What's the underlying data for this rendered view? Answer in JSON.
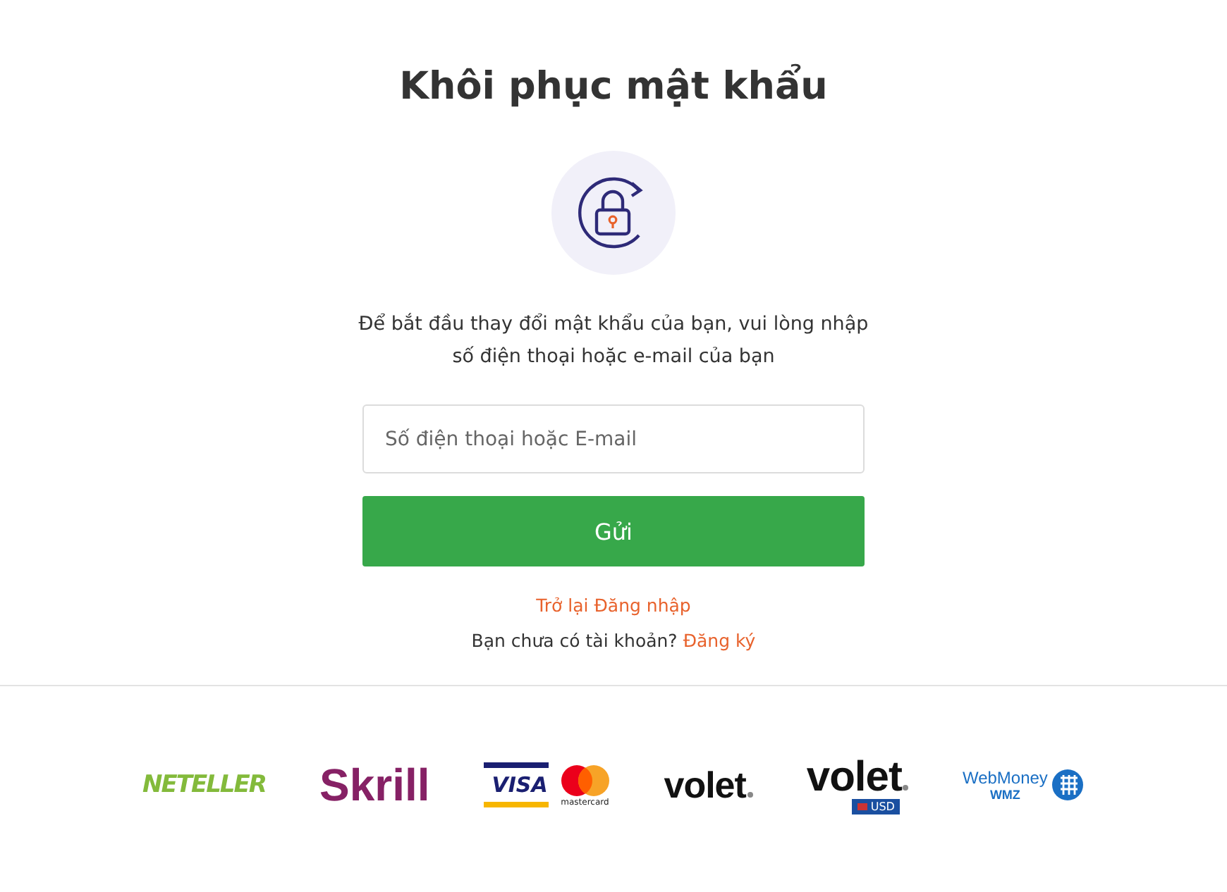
{
  "title": "Khôi phục mật khẩu",
  "description": "Để bắt đầu thay đổi mật khẩu của bạn, vui lòng nhập số điện thoại hoặc e-mail của bạn",
  "field": {
    "placeholder": "Số điện thoại hoặc E-mail"
  },
  "submit_button": "Gửi",
  "back_link": "Trở lại Đăng nhập",
  "signup": {
    "text": "Bạn chưa có tài khoản?",
    "link": "Đăng ký"
  },
  "payment_logos": [
    {
      "kind": "neteller",
      "text": "NETELLER"
    },
    {
      "kind": "skrill",
      "text": "Skrill"
    },
    {
      "kind": "card",
      "text": "VISA",
      "subtext": "mastercard"
    },
    {
      "kind": "volet",
      "text": "volet"
    },
    {
      "kind": "volet",
      "text": "volet",
      "badge": "USD"
    },
    {
      "kind": "webmoney",
      "text": "WebMoney",
      "subtext": "WMZ"
    }
  ]
}
